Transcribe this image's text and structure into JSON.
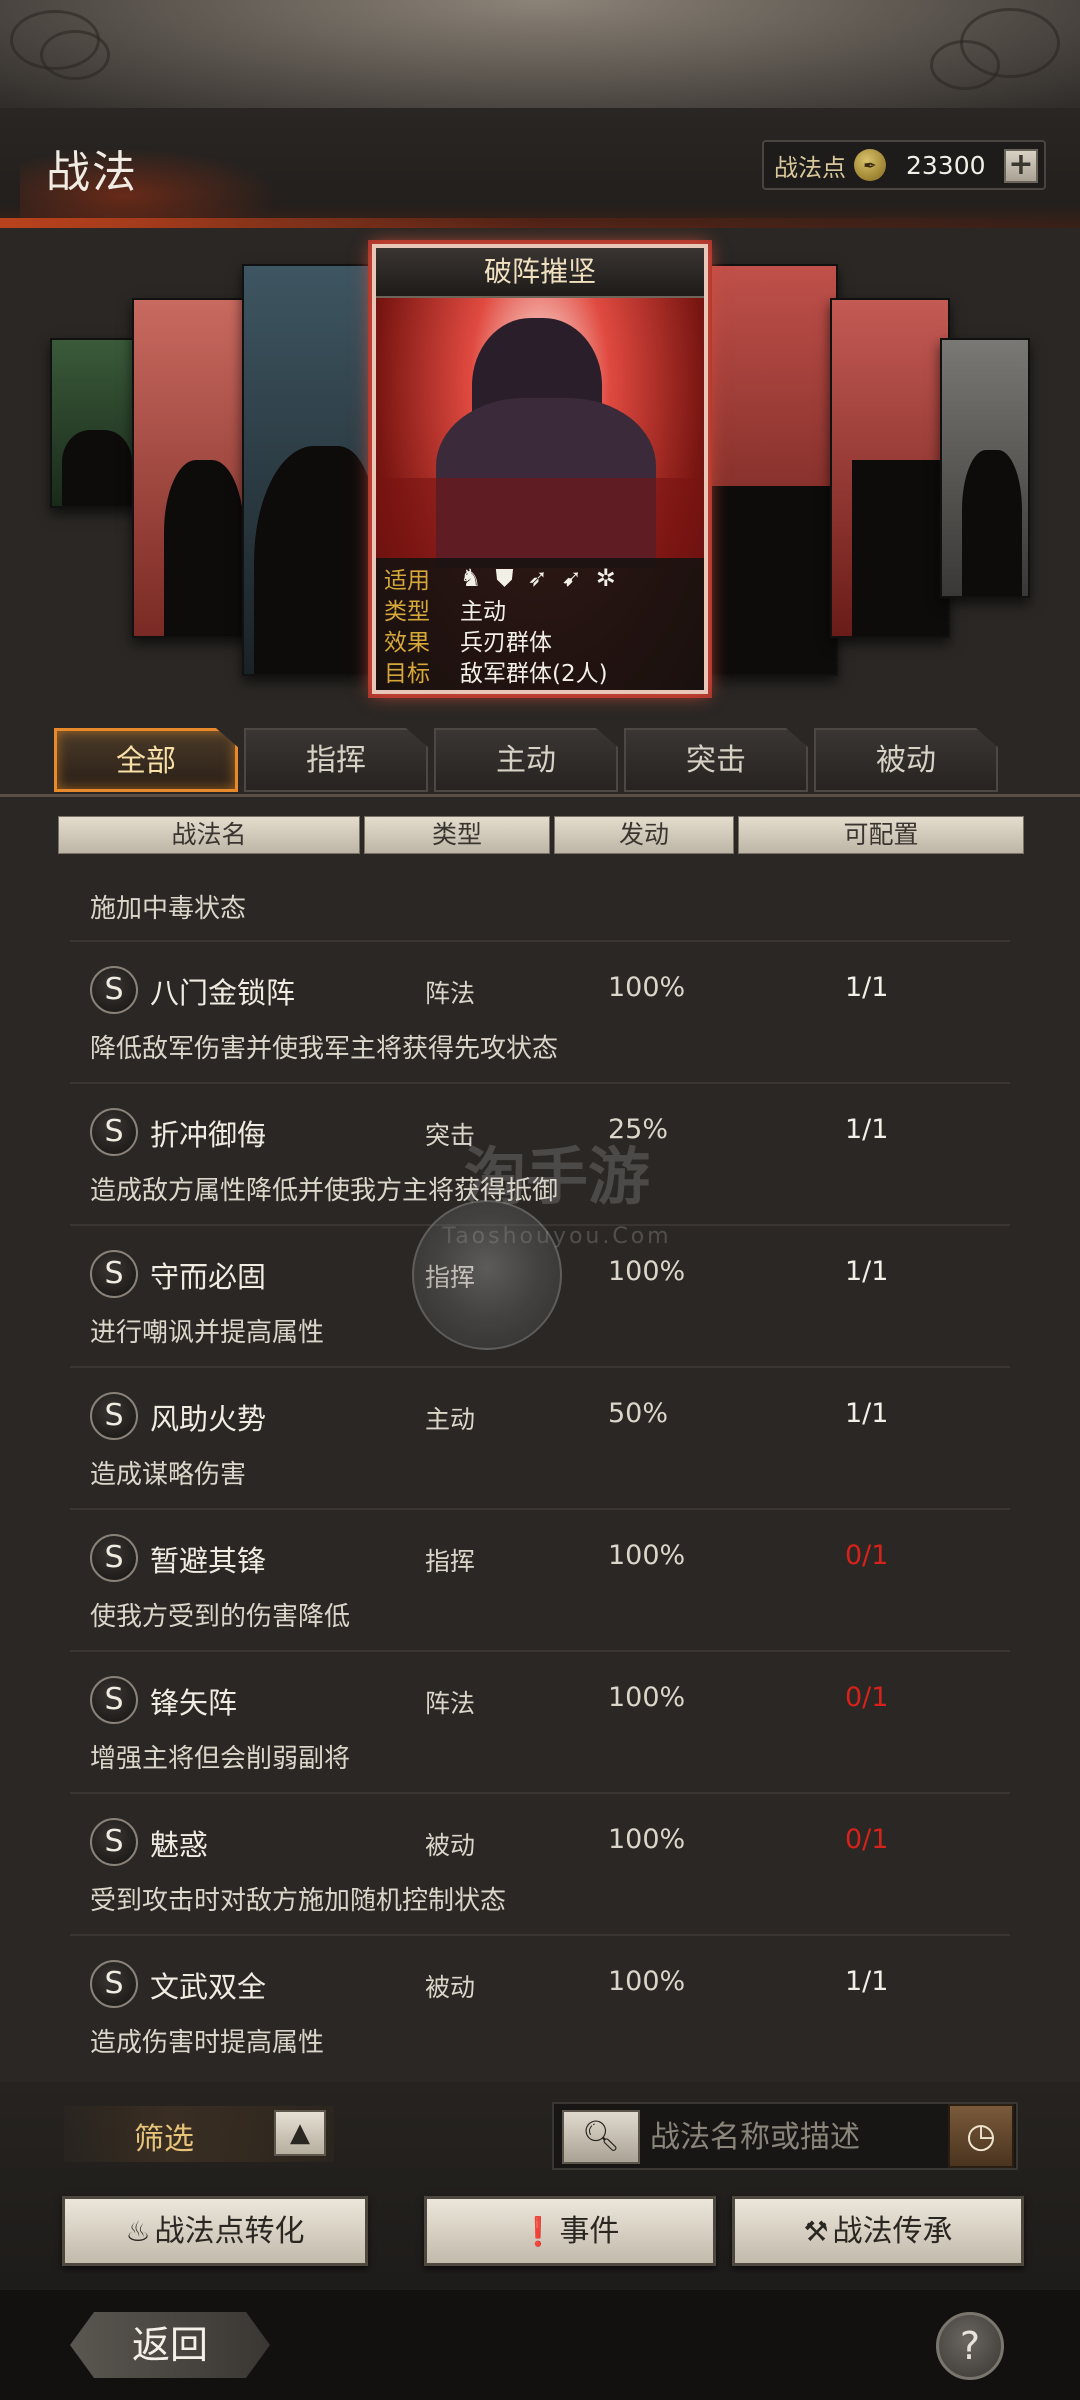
{
  "header": {
    "title": "战法",
    "points_label": "战法点",
    "points_value": "23300",
    "plus_label": "+"
  },
  "featured_card": {
    "title": "破阵摧坚",
    "rows": [
      {
        "key": "适用",
        "value": ""
      },
      {
        "key": "类型",
        "value": "主动"
      },
      {
        "key": "效果",
        "value": "兵刃群体"
      },
      {
        "key": "目标",
        "value": "敌军群体(2人)"
      }
    ],
    "unit_icons": [
      "cavalry-icon",
      "shield-icon",
      "bow-icon",
      "spear-icon",
      "wheel-icon"
    ]
  },
  "tabs": [
    {
      "label": "全部",
      "active": true
    },
    {
      "label": "指挥",
      "active": false
    },
    {
      "label": "主动",
      "active": false
    },
    {
      "label": "突击",
      "active": false
    },
    {
      "label": "被动",
      "active": false
    }
  ],
  "columns": [
    "战法名",
    "类型",
    "发动",
    "可配置"
  ],
  "first_desc": "施加中毒状态",
  "rows": [
    {
      "grade": "S",
      "name": "八门金锁阵",
      "type": "阵法",
      "rate": "100%",
      "avail": "1/1",
      "desc": "降低敌军伤害并使我军主将获得先攻状态"
    },
    {
      "grade": "S",
      "name": "折冲御侮",
      "type": "突击",
      "rate": "25%",
      "avail": "1/1",
      "desc": "造成敌方属性降低并使我方主将获得抵御"
    },
    {
      "grade": "S",
      "name": "守而必固",
      "type": "指挥",
      "rate": "100%",
      "avail": "1/1",
      "desc": "进行嘲讽并提高属性"
    },
    {
      "grade": "S",
      "name": "风助火势",
      "type": "主动",
      "rate": "50%",
      "avail": "1/1",
      "desc": "造成谋略伤害"
    },
    {
      "grade": "S",
      "name": "暂避其锋",
      "type": "指挥",
      "rate": "100%",
      "avail": "0/1",
      "desc": "使我方受到的伤害降低"
    },
    {
      "grade": "S",
      "name": "锋矢阵",
      "type": "阵法",
      "rate": "100%",
      "avail": "0/1",
      "desc": "增强主将但会削弱副将"
    },
    {
      "grade": "S",
      "name": "魅惑",
      "type": "被动",
      "rate": "100%",
      "avail": "0/1",
      "desc": "受到攻击时对敌方施加随机控制状态"
    },
    {
      "grade": "S",
      "name": "文武双全",
      "type": "被动",
      "rate": "100%",
      "avail": "1/1",
      "desc": "造成伤害时提高属性"
    }
  ],
  "watermark": {
    "brand": "淘手游",
    "url": "Taoshouyou.Com"
  },
  "bottom": {
    "filter_label": "筛选",
    "search_placeholder": "战法名称或描述",
    "convert_label": "战法点转化",
    "event_label": "事件",
    "inherit_label": "战法传承"
  },
  "footer": {
    "back_label": "返回",
    "help_label": "?"
  },
  "colors": {
    "accent": "#e88a2c",
    "unavailable": "#d6221a",
    "card_glow": "#a5332a"
  }
}
